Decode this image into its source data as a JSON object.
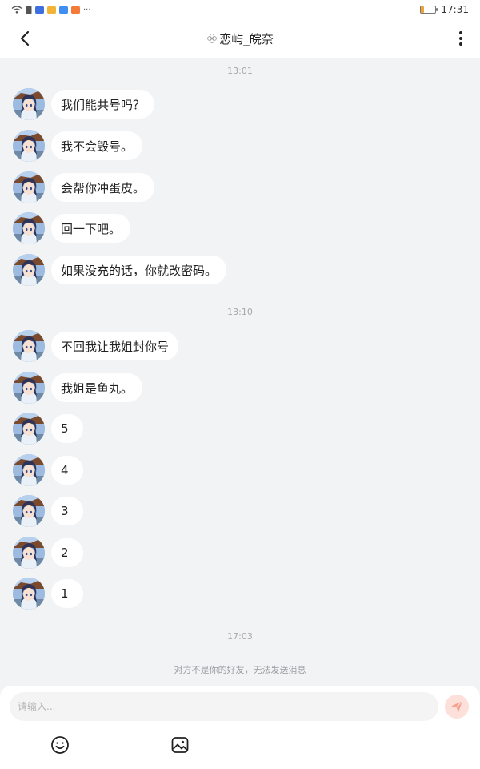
{
  "status_bar": {
    "time": "17:31",
    "battery_level": 0.2,
    "more_indicator": "···",
    "icons": [
      "wifi-icon",
      "sim-icon",
      "app-icon-blue",
      "app-icon-yellow",
      "cloud-icon",
      "app-icon-orange"
    ]
  },
  "header": {
    "title": "恋屿_皖奈",
    "title_icon": "flower-icon",
    "back_icon": "back-arrow-icon",
    "more_icon": "more-vertical-icon"
  },
  "chat": {
    "timestamps": [
      "13:01",
      "13:10",
      "17:03"
    ],
    "group1": [
      {
        "text": "我们能共号吗？"
      },
      {
        "text": "我不会毁号。"
      },
      {
        "text": "会帮你冲蛋皮。"
      },
      {
        "text": "回一下吧。"
      },
      {
        "text": "如果没充的话，你就改密码。"
      }
    ],
    "group2": [
      {
        "text": "不回我让我姐封你号"
      },
      {
        "text": "我姐是鱼丸。"
      },
      {
        "text": "5"
      },
      {
        "text": "4"
      },
      {
        "text": "3"
      },
      {
        "text": "2"
      },
      {
        "text": "1"
      }
    ],
    "notice": "对方不是你的好友，无法发送消息"
  },
  "composer": {
    "placeholder": "请输入...",
    "send_icon": "send-icon",
    "emoji_icon": "emoji-icon",
    "image_icon": "image-icon"
  },
  "colors": {
    "background": "#f2f3f5",
    "bubble": "#ffffff",
    "send_button": "#fde0d9",
    "send_arrow": "#f4a391",
    "battery": "#f0a431"
  }
}
